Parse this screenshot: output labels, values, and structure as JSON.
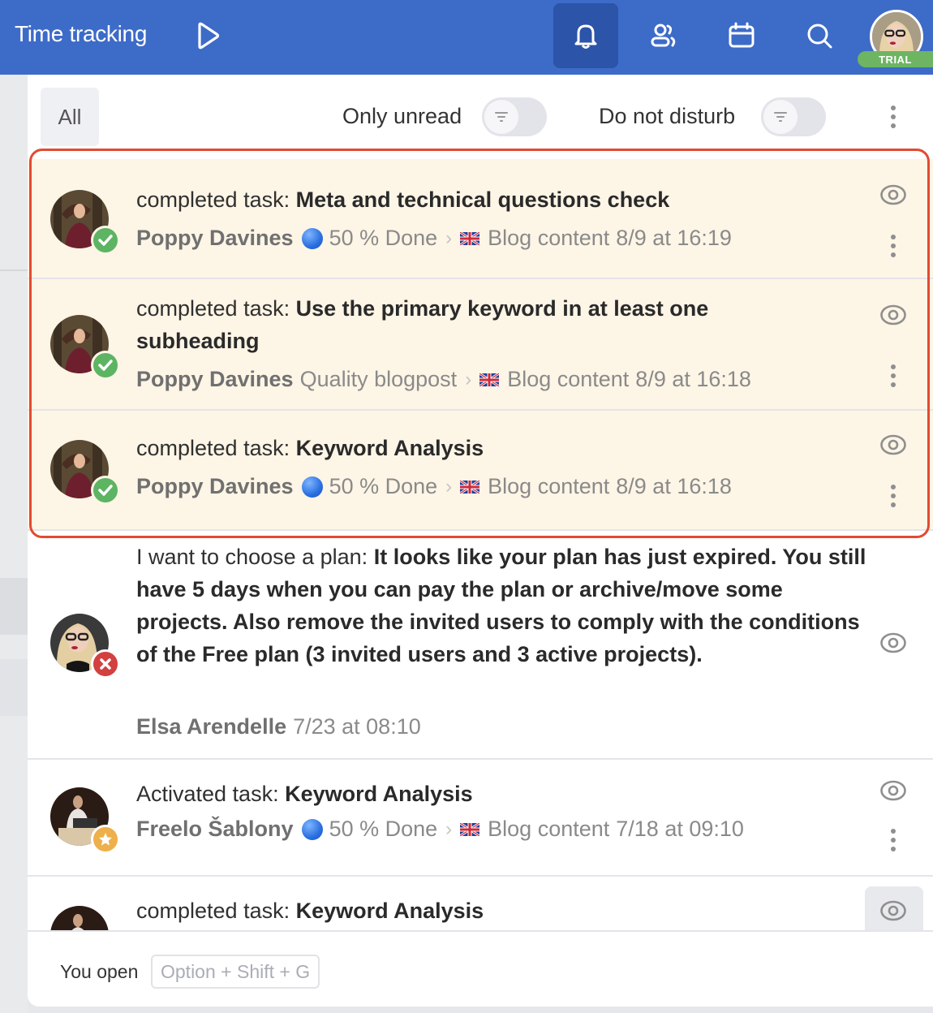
{
  "header": {
    "title": "Time tracking",
    "play_icon": "play-icon",
    "nav": [
      {
        "name": "notifications",
        "icon": "bell-icon",
        "active": true
      },
      {
        "name": "users",
        "icon": "users-icon",
        "active": false
      },
      {
        "name": "calendar",
        "icon": "calendar-icon",
        "active": false
      },
      {
        "name": "search",
        "icon": "search-icon",
        "active": false
      }
    ],
    "user_badge": "TRIAL",
    "brand_color": "#3d6bc8"
  },
  "filters": {
    "all_label": "All",
    "only_unread_label": "Only unread",
    "only_unread_on": false,
    "do_not_disturb_label": "Do not disturb",
    "do_not_disturb_on": false
  },
  "notifications": [
    {
      "action": "completed task: ",
      "subject": "Meta and technical questions check",
      "author": "Poppy Davines",
      "status": "50 % Done",
      "project": "Blog content",
      "time": "8/9 at 16:19",
      "badge": "check",
      "highlighted": true
    },
    {
      "action": "completed task: ",
      "subject": "Use the primary keyword in at least one subheading",
      "author": "Poppy Davines",
      "status": "Quality blogpost",
      "project": "Blog content",
      "time": "8/9 at 16:18",
      "badge": "check",
      "highlighted": true
    },
    {
      "action": "completed task: ",
      "subject": "Keyword Analysis",
      "author": "Poppy Davines",
      "status": "50 % Done",
      "project": "Blog content",
      "time": "8/9 at 16:18",
      "badge": "check",
      "highlighted": true
    },
    {
      "action": "I want to choose a plan: ",
      "subject": "It looks like your plan has just expired. You still have 5 days when you can pay the plan or archive/move some projects. Also remove the invited users to comply with the conditions of the Free plan (3 invited users and 3 active projects).",
      "author": "Elsa Arendelle",
      "time": "7/23 at 08:10",
      "badge": "cross",
      "highlighted": false
    },
    {
      "action": "Activated task: ",
      "subject": "Keyword Analysis",
      "author": "Freelo Šablony",
      "status": "50 % Done",
      "project": "Blog content",
      "time": "7/18 at 09:10",
      "badge": "star",
      "highlighted": false
    },
    {
      "action": "completed task: ",
      "subject": "Keyword Analysis",
      "highlighted": false
    }
  ],
  "footer": {
    "label": "You open",
    "shortcut": "Option + Shift + G"
  },
  "colors": {
    "highlight_bg": "#fdf5e6",
    "highlight_border": "#e24a33",
    "badge_check": "#5db463",
    "badge_cross": "#d24040",
    "badge_star": "#eeb04b",
    "trial": "#6db563"
  }
}
